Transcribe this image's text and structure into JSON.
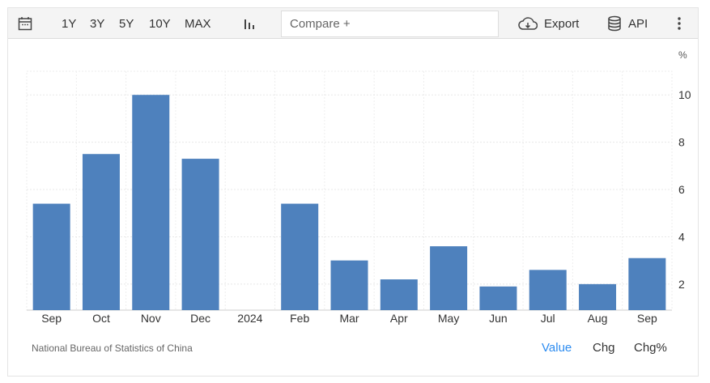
{
  "toolbar": {
    "ranges": [
      "1Y",
      "3Y",
      "5Y",
      "10Y",
      "MAX"
    ],
    "compare_placeholder": "Compare +",
    "export_label": "Export",
    "api_label": "API"
  },
  "chart_data": {
    "type": "bar",
    "categories": [
      "Sep",
      "Oct",
      "Nov",
      "Dec",
      "2024",
      "Feb",
      "Mar",
      "Apr",
      "May",
      "Jun",
      "Jul",
      "Aug",
      "Sep"
    ],
    "values": [
      5.4,
      7.5,
      10.0,
      7.3,
      null,
      5.4,
      3.0,
      2.2,
      3.6,
      1.9,
      2.6,
      2.0,
      3.1
    ],
    "ylabel": "%",
    "yticks": [
      2,
      4,
      6,
      8,
      10
    ],
    "ylim": [
      0.9,
      11
    ],
    "grid": true,
    "bar_color": "#4e81bd"
  },
  "footer": {
    "source": "National Bureau of Statistics of China",
    "tabs": [
      "Value",
      "Chg",
      "Chg%"
    ],
    "active_color": "#2d8cf0"
  }
}
